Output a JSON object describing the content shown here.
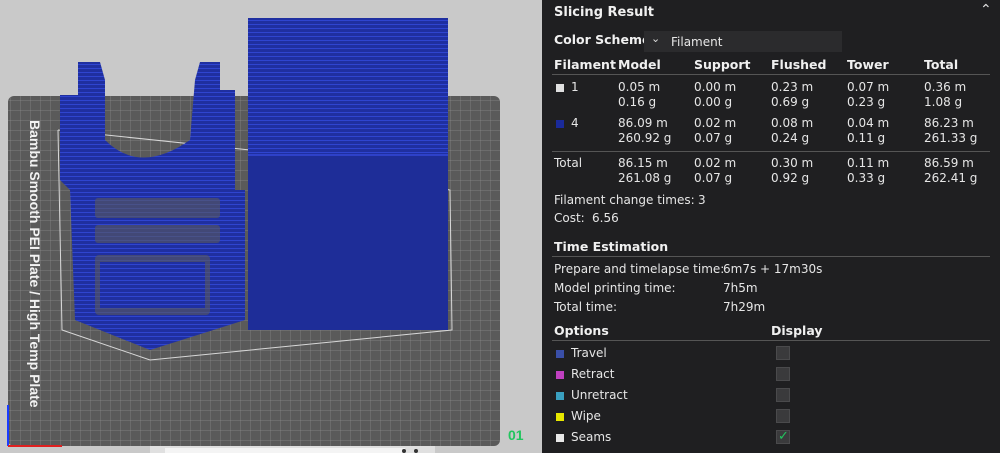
{
  "panel": {
    "title": "Slicing Result",
    "collapse_icon": "chevron-up-double-icon",
    "color_scheme_label": "Color Scheme",
    "color_scheme_value": "Filament",
    "headers": [
      "Filament",
      "Model",
      "Support",
      "Flushed",
      "Tower",
      "Total"
    ],
    "rows": [
      {
        "id": "1",
        "color": "#e0e0e0",
        "model": [
          "0.05 m",
          "0.16 g"
        ],
        "support": [
          "0.00 m",
          "0.00 g"
        ],
        "flushed": [
          "0.23 m",
          "0.69 g"
        ],
        "tower": [
          "0.07 m",
          "0.23 g"
        ],
        "total": [
          "0.36 m",
          "1.08 g"
        ]
      },
      {
        "id": "4",
        "color": "#1a2a9a",
        "model": [
          "86.09 m",
          "260.92 g"
        ],
        "support": [
          "0.02 m",
          "0.07 g"
        ],
        "flushed": [
          "0.08 m",
          "0.24 g"
        ],
        "tower": [
          "0.04 m",
          "0.11 g"
        ],
        "total": [
          "86.23 m",
          "261.33 g"
        ]
      }
    ],
    "total_row": {
      "label": "Total",
      "model": [
        "86.15 m",
        "261.08 g"
      ],
      "support": [
        "0.02 m",
        "0.07 g"
      ],
      "flushed": [
        "0.30 m",
        "0.92 g"
      ],
      "tower": [
        "0.11 m",
        "0.33 g"
      ],
      "total": [
        "86.59 m",
        "262.41 g"
      ]
    },
    "filament_change_label": "Filament change times:",
    "filament_change_value": "3",
    "cost_label": "Cost:",
    "cost_value": "6.56",
    "time_title": "Time Estimation",
    "time_rows": [
      {
        "label": "Prepare and timelapse time:",
        "value": "6m7s + 17m30s"
      },
      {
        "label": "Model printing time:",
        "value": "7h5m"
      },
      {
        "label": "Total time:",
        "value": "7h29m"
      }
    ],
    "options_header": "Options",
    "display_header": "Display",
    "options": [
      {
        "label": "Travel",
        "color": "#3a4fa8",
        "checked": false
      },
      {
        "label": "Retract",
        "color": "#c040c0",
        "checked": false
      },
      {
        "label": "Unretract",
        "color": "#3aa0c0",
        "checked": false
      },
      {
        "label": "Wipe",
        "color": "#e8e800",
        "checked": false
      },
      {
        "label": "Seams",
        "color": "#e8e8e8",
        "checked": true
      }
    ]
  },
  "viewport": {
    "plate_text": "Bambu Smooth PEI Plate / High Temp Plate",
    "plate_number": "01",
    "model_color": "#1f2fa0"
  }
}
